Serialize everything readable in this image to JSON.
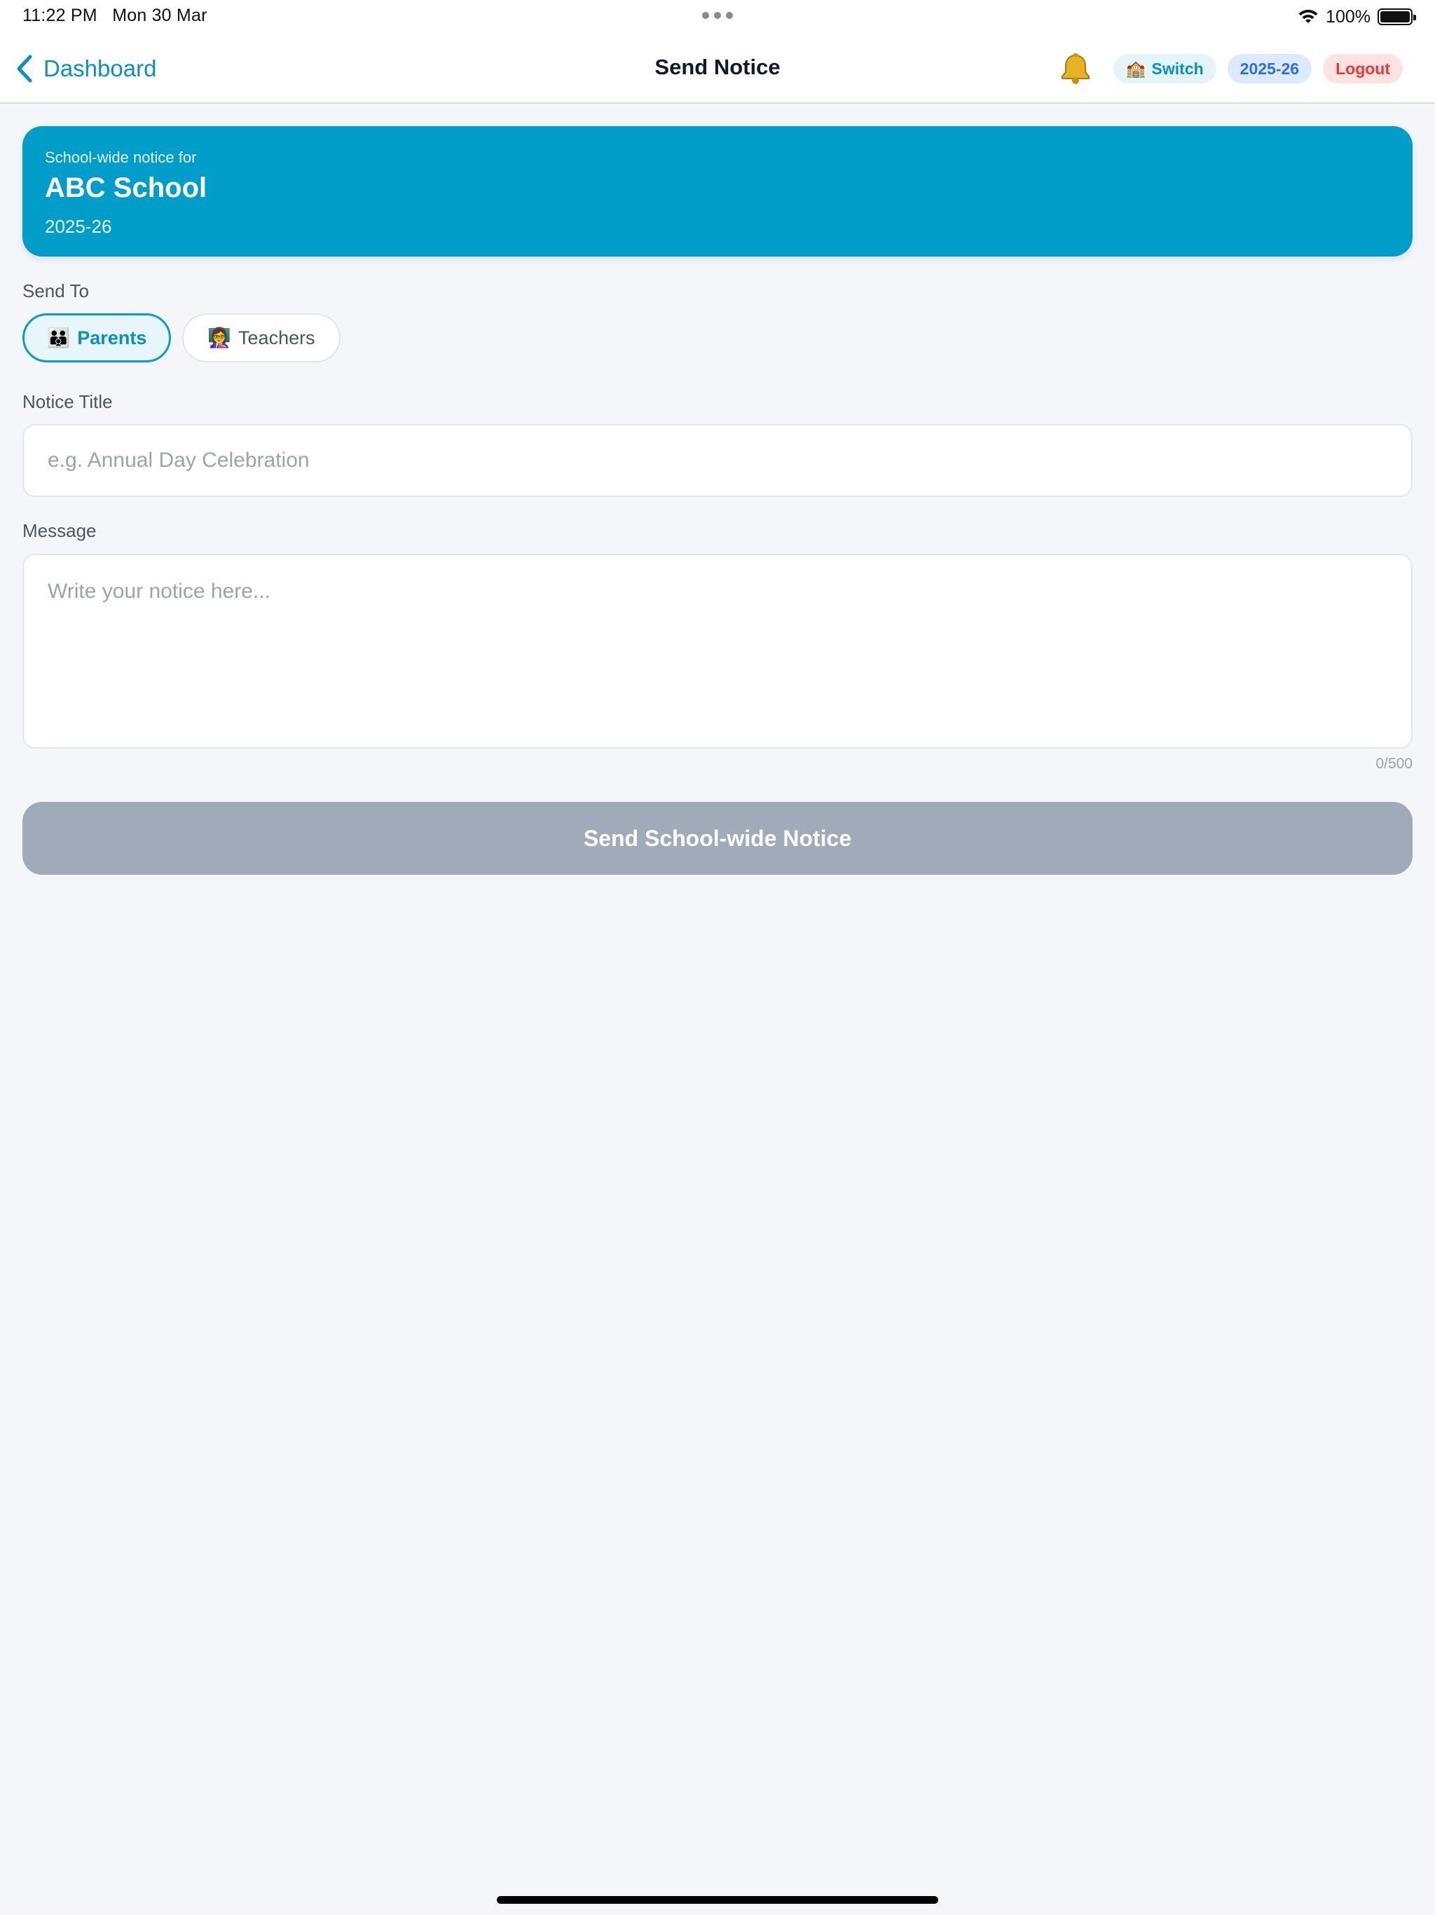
{
  "status_bar": {
    "time": "11:22 PM",
    "date": "Mon 30 Mar",
    "battery": "100%"
  },
  "nav": {
    "back_label": "Dashboard",
    "title": "Send Notice",
    "switch_label": "Switch",
    "switch_icon": "🏫",
    "year_label": "2025-26",
    "logout_label": "Logout",
    "bell_icon": "🔔"
  },
  "banner": {
    "subtitle": "School-wide notice for",
    "school_name": "ABC School",
    "year": "2025-26",
    "color": "#009dc9"
  },
  "form": {
    "send_to_label": "Send To",
    "recipients": [
      {
        "label": "Parents",
        "icon": "👪",
        "selected": true
      },
      {
        "label": "Teachers",
        "icon": "👩‍🏫",
        "selected": false
      }
    ],
    "title_label": "Notice Title",
    "title_placeholder": "e.g. Annual Day Celebration",
    "title_value": "",
    "message_label": "Message",
    "message_placeholder": "Write your notice here...",
    "message_value": "",
    "counter": "0/500",
    "submit_label": "Send School-wide Notice"
  }
}
